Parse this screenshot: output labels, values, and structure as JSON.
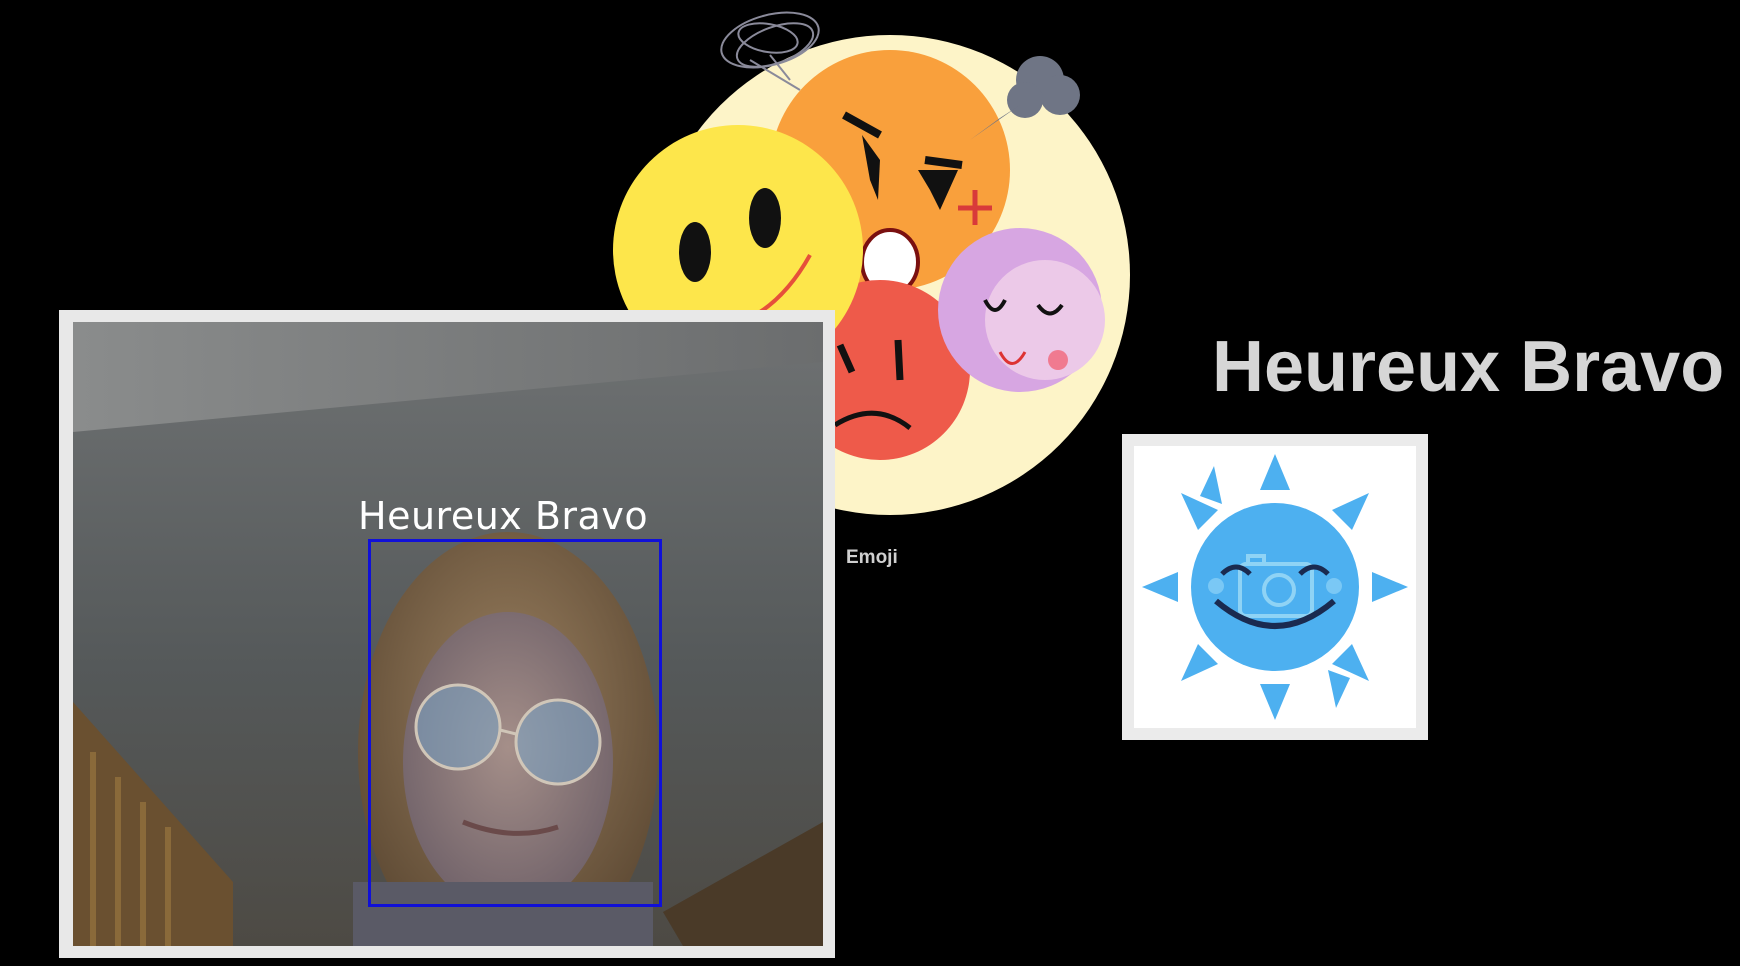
{
  "emoji_panel": {
    "caption": "Emoji"
  },
  "webcam": {
    "face_label": "Heureux Bravo"
  },
  "prediction": {
    "label": "Heureux Bravo"
  },
  "colors": {
    "background": "#000000",
    "face_box": "#1010d8",
    "caption_text": "#cfcfcf",
    "heading_text": "#d6d6d6",
    "sun_icon": "#4db0f0"
  },
  "icons": {
    "emoji_art": "emotion-faces-icon",
    "result": "happy-sun-camera-icon"
  }
}
